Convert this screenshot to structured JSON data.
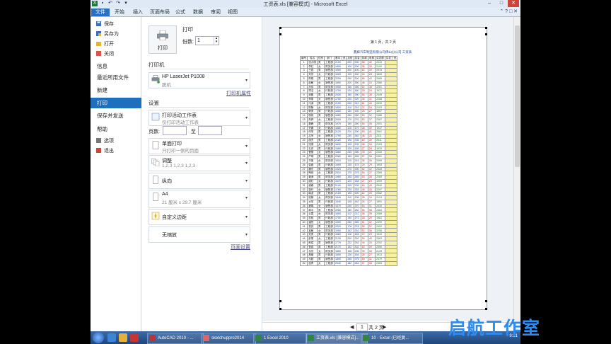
{
  "window": {
    "title": "工资表.xls [兼容模式] - Microsoft Excel",
    "qat_icons": [
      "excel-icon",
      "save-icon",
      "undo-icon",
      "redo-icon",
      "dropdown-icon"
    ],
    "controls": [
      "–",
      "□",
      "✕"
    ]
  },
  "ribbon": {
    "tabs": [
      "文件",
      "开始",
      "插入",
      "页面布局",
      "公式",
      "数据",
      "审阅",
      "视图"
    ],
    "right_icons": "⌃ ? □ ✕"
  },
  "nav": {
    "small_top": [
      "保存",
      "另存为",
      "打开",
      "关闭"
    ],
    "big": [
      "信息",
      "最近所用文件",
      "新建",
      "打印",
      "保存并发送",
      "帮助"
    ],
    "small_bottom": [
      "选项",
      "退出"
    ],
    "active": "打印"
  },
  "print": {
    "section_title": "打印",
    "button_label": "打印",
    "copies_label": "份数:",
    "copies_value": "1",
    "printer_title": "打印机",
    "printer_name": "HP LaserJet P1008",
    "printer_status": "脱机",
    "printer_props": "打印机属性",
    "settings_title": "设置",
    "setting1_main": "打印活动工作表",
    "setting1_sub": "仅打印活动工作表",
    "pages_label": "页数:",
    "pages_to": "至",
    "setting2_main": "单面打印",
    "setting2_sub": "只打印一侧的页面",
    "setting3_main": "调整",
    "setting3_sub": "1,2,3    1,2,3    1,2,3",
    "setting4_main": "纵向",
    "setting5_main": "A4",
    "setting5_sub": "21 厘米 x 29.7 厘米",
    "setting6_main": "自定义边距",
    "setting7_main": "无缩放",
    "page_setup": "页面设置"
  },
  "preview": {
    "page_header": "第 1 页，共 2 页",
    "sheet_title": "鑫辉汽车制造有限公司佛山分公司    工资表",
    "columns": [
      "编号",
      "姓名",
      "性别",
      "部门",
      "基本工资",
      "加班",
      "奖金",
      "扣款",
      "电费",
      "实发额",
      "实发工资"
    ],
    "rows": [
      [
        "1",
        "张大明",
        "男",
        "工程部",
        "2100",
        "200",
        "300",
        "58",
        "40",
        "2543"
      ],
      [
        "2",
        "李红",
        "女",
        "财务部",
        "1800",
        "100",
        "200",
        "36",
        "35",
        "2100"
      ],
      [
        "3",
        "王强",
        "男",
        "销售部",
        "1900",
        "300",
        "400",
        "62",
        "30",
        "2578"
      ],
      [
        "4",
        "刘芳",
        "女",
        "行政部",
        "1600",
        "100",
        "150",
        "24",
        "28",
        "1826"
      ],
      [
        "5",
        "陈刚",
        "男",
        "工程部",
        "2200",
        "250",
        "300",
        "65",
        "42",
        "2685"
      ],
      [
        "6",
        "赵敏",
        "女",
        "销售部",
        "1850",
        "200",
        "350",
        "48",
        "33",
        "2386"
      ],
      [
        "7",
        "孙伟",
        "男",
        "财务部",
        "1950",
        "150",
        "250",
        "52",
        "36",
        "2281"
      ],
      [
        "8",
        "周洁",
        "女",
        "行政部",
        "1700",
        "120",
        "180",
        "30",
        "29",
        "1971"
      ],
      [
        "9",
        "吴磊",
        "男",
        "工程部",
        "2050",
        "180",
        "280",
        "56",
        "38",
        "2449"
      ],
      [
        "10",
        "郑丽",
        "女",
        "销售部",
        "1750",
        "220",
        "320",
        "44",
        "31",
        "2258"
      ],
      [
        "11",
        "冯涛",
        "男",
        "工程部",
        "2150",
        "240",
        "310",
        "61",
        "40",
        "2639"
      ],
      [
        "12",
        "陈静",
        "女",
        "财务部",
        "1820",
        "110",
        "210",
        "37",
        "34",
        "2103"
      ],
      [
        "13",
        "韩勇",
        "男",
        "行政部",
        "1650",
        "130",
        "160",
        "26",
        "27",
        "1897"
      ],
      [
        "14",
        "杨帆",
        "男",
        "销售部",
        "1880",
        "260",
        "380",
        "50",
        "32",
        "2486"
      ],
      [
        "15",
        "朱婷",
        "女",
        "工程部",
        "2000",
        "170",
        "270",
        "53",
        "37",
        "2387"
      ],
      [
        "16",
        "秦峰",
        "男",
        "财务部",
        "1970",
        "160",
        "260",
        "54",
        "35",
        "2301"
      ],
      [
        "17",
        "许娜",
        "女",
        "行政部",
        "1680",
        "115",
        "170",
        "28",
        "30",
        "1937"
      ],
      [
        "18",
        "何军",
        "男",
        "工程部",
        "2120",
        "210",
        "290",
        "59",
        "41",
        "2561"
      ],
      [
        "19",
        "吕萍",
        "女",
        "销售部",
        "1790",
        "230",
        "340",
        "46",
        "33",
        "2311"
      ],
      [
        "20",
        "施杰",
        "男",
        "工程部",
        "2180",
        "190",
        "305",
        "63",
        "39",
        "2611"
      ],
      [
        "21",
        "张燕",
        "女",
        "财务部",
        "1830",
        "105",
        "205",
        "38",
        "34",
        "2103"
      ],
      [
        "22",
        "孔亮",
        "男",
        "行政部",
        "1660",
        "125",
        "165",
        "27",
        "28",
        "1933"
      ],
      [
        "23",
        "曹雪",
        "女",
        "销售部",
        "1860",
        "245",
        "360",
        "49",
        "31",
        "2426"
      ],
      [
        "24",
        "严明",
        "男",
        "工程部",
        "2080",
        "185",
        "285",
        "57",
        "38",
        "2481"
      ],
      [
        "25",
        "华丽",
        "女",
        "财务部",
        "1810",
        "115",
        "215",
        "36",
        "35",
        "2099"
      ],
      [
        "26",
        "金鑫",
        "男",
        "行政部",
        "1690",
        "135",
        "175",
        "29",
        "29",
        "1953"
      ],
      [
        "27",
        "魏东",
        "男",
        "销售部",
        "1920",
        "270",
        "390",
        "52",
        "32",
        "2528"
      ],
      [
        "28",
        "陶然",
        "女",
        "工程部",
        "2010",
        "175",
        "275",
        "54",
        "37",
        "2369"
      ],
      [
        "29",
        "姜涛",
        "男",
        "财务部",
        "1960",
        "155",
        "255",
        "53",
        "36",
        "2283"
      ],
      [
        "30",
        "戚红",
        "女",
        "行政部",
        "1670",
        "120",
        "168",
        "27",
        "29",
        "1909"
      ],
      [
        "31",
        "谢峰",
        "男",
        "工程部",
        "2140",
        "205",
        "295",
        "60",
        "40",
        "2540"
      ],
      [
        "32",
        "邹玲",
        "女",
        "销售部",
        "1780",
        "225",
        "335",
        "45",
        "33",
        "2297"
      ],
      [
        "33",
        "喻波",
        "男",
        "工程部",
        "2160",
        "195",
        "300",
        "62",
        "39",
        "2582"
      ],
      [
        "34",
        "柏静",
        "女",
        "财务部",
        "1840",
        "110",
        "208",
        "38",
        "34",
        "2124"
      ],
      [
        "35",
        "水军",
        "男",
        "行政部",
        "1640",
        "128",
        "162",
        "26",
        "27",
        "1891"
      ],
      [
        "36",
        "窦娟",
        "女",
        "销售部",
        "1870",
        "250",
        "370",
        "50",
        "31",
        "2439"
      ],
      [
        "37",
        "章平",
        "男",
        "工程部",
        "2060",
        "180",
        "282",
        "56",
        "38",
        "2464"
      ],
      [
        "38",
        "云霞",
        "女",
        "财务部",
        "1800",
        "112",
        "212",
        "36",
        "35",
        "2089"
      ],
      [
        "39",
        "苏航",
        "男",
        "行政部",
        "1700",
        "130",
        "172",
        "28",
        "29",
        "1961"
      ],
      [
        "40",
        "潘悦",
        "女",
        "销售部",
        "1900",
        "265",
        "385",
        "51",
        "32",
        "2499"
      ],
      [
        "41",
        "葛亮",
        "男",
        "工程部",
        "2020",
        "178",
        "278",
        "55",
        "37",
        "2402"
      ],
      [
        "42",
        "奚敏",
        "女",
        "财务部",
        "1950",
        "152",
        "252",
        "52",
        "36",
        "2258"
      ],
      [
        "43",
        "范勇",
        "男",
        "行政部",
        "1660",
        "118",
        "166",
        "27",
        "29",
        "1910"
      ],
      [
        "44",
        "彭丽",
        "女",
        "工程部",
        "2130",
        "200",
        "292",
        "59",
        "40",
        "2563"
      ],
      [
        "45",
        "郎斌",
        "男",
        "销售部",
        "1770",
        "222",
        "332",
        "44",
        "33",
        "2292"
      ],
      [
        "46",
        "鲁强",
        "男",
        "工程部",
        "2170",
        "192",
        "302",
        "63",
        "39",
        "2596"
      ],
      [
        "47",
        "韦芳",
        "女",
        "财务部",
        "1850",
        "108",
        "206",
        "39",
        "34",
        "2125"
      ],
      [
        "48",
        "昌盛",
        "男",
        "行政部",
        "1650",
        "126",
        "164",
        "26",
        "27",
        "1913"
      ],
      [
        "49",
        "马超",
        "男",
        "销售部",
        "1890",
        "255",
        "375",
        "50",
        "31",
        "2479"
      ],
      [
        "50",
        "苗青",
        "女",
        "工程部",
        "2040",
        "182",
        "284",
        "57",
        "38",
        "2453"
      ]
    ],
    "page_nav": {
      "current": "1",
      "total": "共 2 页",
      "prev": "◀",
      "next": "▶"
    }
  },
  "taskbar": {
    "tasks": [
      "AutoCAD 2010 - ...",
      "sketchuppro2014",
      "1 Excel 2010",
      "工资表.xls [兼容模式]...",
      "10 - Excel (已经复..."
    ],
    "time": "9:51"
  },
  "watermark": "启航工作室"
}
